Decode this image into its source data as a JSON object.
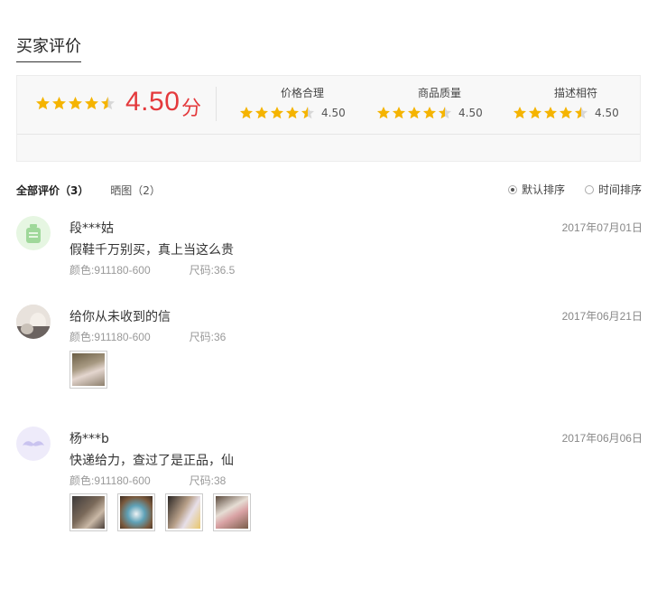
{
  "section_title": "买家评价",
  "summary": {
    "overall_score": "4.50",
    "overall_unit": "分",
    "overall_rating": 4.5,
    "metrics": [
      {
        "label": "价格合理",
        "value": "4.50",
        "rating": 4.5
      },
      {
        "label": "商品质量",
        "value": "4.50",
        "rating": 4.5
      },
      {
        "label": "描述相符",
        "value": "4.50",
        "rating": 4.5
      }
    ]
  },
  "tabs": {
    "all": "全部评价（3）",
    "photos": "晒图（2）"
  },
  "sort": {
    "default": "默认排序",
    "time": "时间排序",
    "selected": "default"
  },
  "reviews": [
    {
      "name": "段***姑",
      "date": "2017年07月01日",
      "text": "假鞋千万别买，真上当这么贵",
      "color": "颜色:911180-600",
      "size": "尺码:36.5",
      "avatar_icon": "bottle-icon"
    },
    {
      "name": "给你从未收到的信",
      "date": "2017年06月21日",
      "text": "",
      "color": "颜色:911180-600",
      "size": "尺码:36",
      "avatar_icon": "user-photo"
    },
    {
      "name": "杨***b",
      "date": "2017年06月06日",
      "text": "快递给力，查过了是正品，仙",
      "color": "颜色:911180-600",
      "size": "尺码:38",
      "avatar_icon": "mustache-icon"
    }
  ],
  "colors": {
    "star": "#f5b400",
    "star_empty": "#d7d7d7",
    "score": "#e4393c"
  }
}
